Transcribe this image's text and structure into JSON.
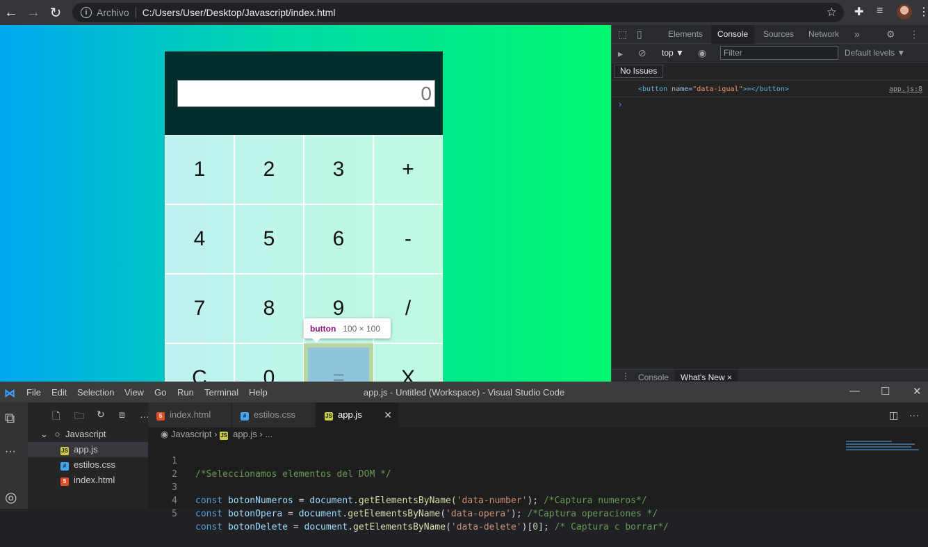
{
  "browser": {
    "scheme_label": "Archivo",
    "url": "C:/Users/User/Desktop/Javascript/index.html"
  },
  "calculator": {
    "display_value": "0",
    "keys": [
      "1",
      "2",
      "3",
      "+",
      "4",
      "5",
      "6",
      "-",
      "7",
      "8",
      "9",
      "/",
      "C",
      "0",
      "=",
      "X"
    ],
    "highlighted_key": "="
  },
  "tooltip": {
    "tag": "button",
    "dims": "100 × 100"
  },
  "devtools": {
    "tabs": [
      "Elements",
      "Console",
      "Sources",
      "Network"
    ],
    "active_tab": "Console",
    "context": "top ▼",
    "filter_placeholder": "Filter",
    "levels": "Default levels ▼",
    "issues": "No Issues",
    "log": {
      "tag_open": "<button ",
      "attr_name": "name=",
      "attr_value": "\"data-igual\"",
      "tag_rest": ">=</button>",
      "source": "app.js:8"
    },
    "prompt": "›",
    "drawer_tabs": [
      "Console",
      "What's New"
    ],
    "drawer_close": "×"
  },
  "vscode": {
    "menu": [
      "File",
      "Edit",
      "Selection",
      "View",
      "Go",
      "Run",
      "Terminal",
      "Help"
    ],
    "window_title": "app.js - Untitled (Workspace) - Visual Studio Code",
    "folder": "Javascript",
    "files": [
      {
        "name": "app.js",
        "type": "js"
      },
      {
        "name": "estilos.css",
        "type": "css"
      },
      {
        "name": "index.html",
        "type": "html"
      }
    ],
    "tabs": [
      {
        "name": "index.html",
        "type": "html"
      },
      {
        "name": "estilos.css",
        "type": "css"
      },
      {
        "name": "app.js",
        "type": "js"
      }
    ],
    "active_tab": "app.js",
    "breadcrumb": {
      "folder": "Javascript",
      "file": "app.js",
      "rest": "..."
    },
    "code_lines": [
      {
        "n": "1",
        "text": "/*Seleccionamos elementos del DOM */"
      },
      {
        "n": "2",
        "text": ""
      },
      {
        "n": "3",
        "text": "const botonNumeros = document.getElementsByName('data-number'); /*Captura numeros*/"
      },
      {
        "n": "4",
        "text": "const botonOpera = document.getElementsByName('data-opera'); /*Captura operaciones */"
      },
      {
        "n": "5",
        "text": "const botonDelete = document.getElementsByName('data-delete')[0]; /* Captura c borrar*/"
      }
    ]
  },
  "icons": {
    "back": "back-arrow-icon",
    "forward": "forward-arrow-icon",
    "reload": "reload-icon",
    "star": "bookmark-star-icon",
    "extensions": "puzzle-icon",
    "settings": "gear-icon"
  }
}
